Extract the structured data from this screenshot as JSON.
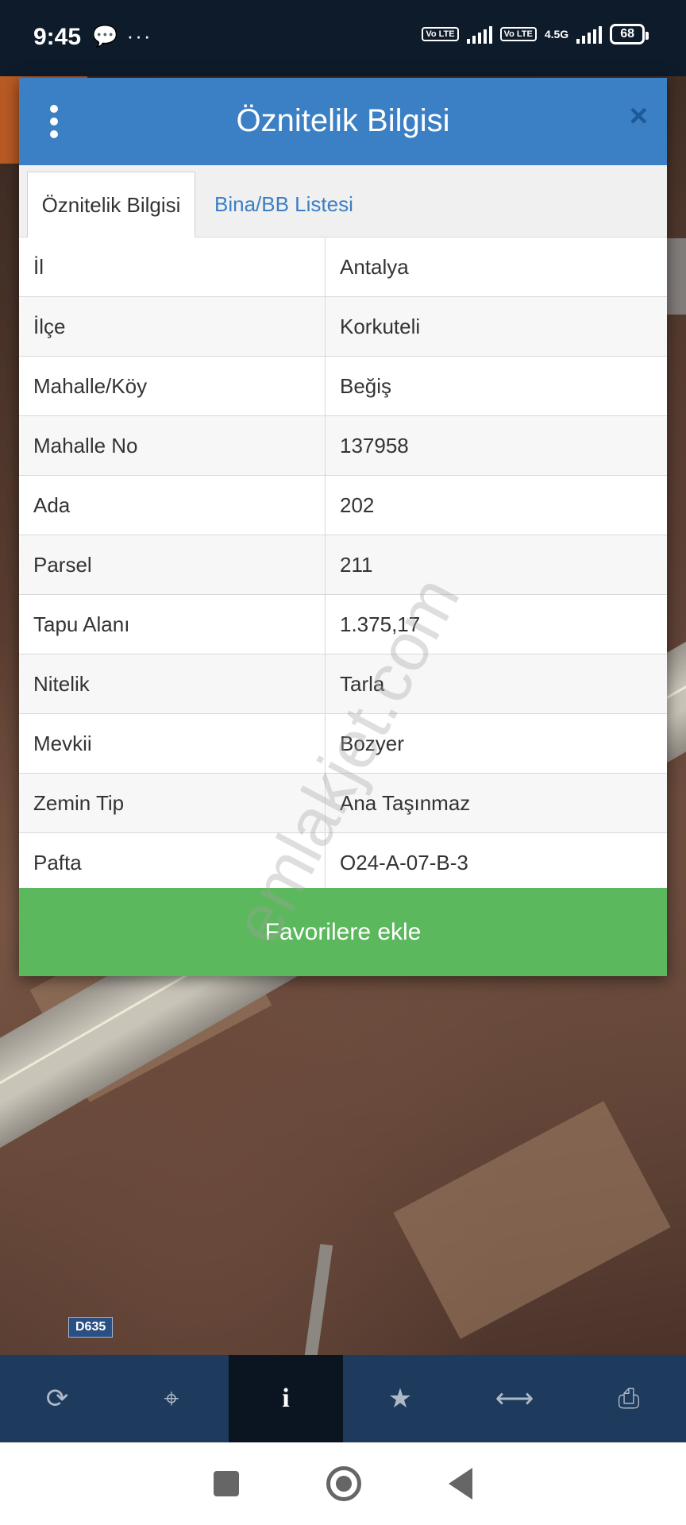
{
  "status_bar": {
    "time": "9:45",
    "left_icons": "💬 ···",
    "network": "4.5G",
    "lte1": "Vo LTE",
    "lte2": "Vo LTE",
    "battery": "68"
  },
  "dialog": {
    "title": "Öznitelik Bilgisi",
    "close_icon": "×",
    "tabs": [
      {
        "label": "Öznitelik Bilgisi",
        "active": true
      },
      {
        "label": "Bina/BB Listesi",
        "active": false
      }
    ],
    "rows": [
      {
        "key": "İl",
        "value": "Antalya"
      },
      {
        "key": "İlçe",
        "value": "Korkuteli"
      },
      {
        "key": "Mahalle/Köy",
        "value": "Beğiş"
      },
      {
        "key": "Mahalle No",
        "value": "137958"
      },
      {
        "key": "Ada",
        "value": "202"
      },
      {
        "key": "Parsel",
        "value": "211"
      },
      {
        "key": "Tapu Alanı",
        "value": "1.375,17"
      },
      {
        "key": "Nitelik",
        "value": "Tarla"
      },
      {
        "key": "Mevkii",
        "value": "Bozyer"
      },
      {
        "key": "Zemin Tip",
        "value": "Ana Taşınmaz"
      },
      {
        "key": "Pafta",
        "value": "O24-A-07-B-3"
      }
    ],
    "favorite_button": "Favorilere ekle"
  },
  "watermark": "emlakjet.com",
  "map": {
    "road_label": "D635"
  },
  "toolbar": {
    "items": [
      {
        "icon": "refresh-icon",
        "glyph": "⟳"
      },
      {
        "icon": "crosshair-icon",
        "glyph": "⌖"
      },
      {
        "icon": "info-icon",
        "glyph": "i",
        "active": true
      },
      {
        "icon": "star-icon",
        "glyph": "★"
      },
      {
        "icon": "measure-icon",
        "glyph": "⟷"
      },
      {
        "icon": "print-icon",
        "glyph": "⎙"
      }
    ]
  },
  "colors": {
    "header": "#3b7fc4",
    "button": "#5cb85c",
    "toolbar": "#1e3a5c"
  }
}
